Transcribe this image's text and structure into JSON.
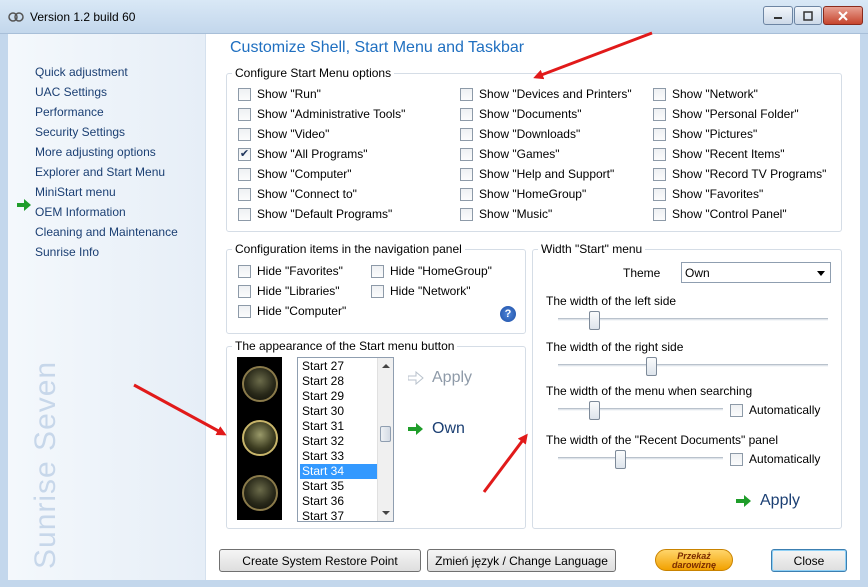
{
  "window": {
    "title": "Version 1.2 build 60"
  },
  "sidebar": {
    "items": [
      {
        "label": "Quick adjustment"
      },
      {
        "label": "UAC Settings"
      },
      {
        "label": "Performance"
      },
      {
        "label": "Security Settings"
      },
      {
        "label": "More adjusting options"
      },
      {
        "label": "Explorer and Start Menu",
        "active": true
      },
      {
        "label": "MiniStart menu"
      },
      {
        "label": "OEM Information"
      },
      {
        "label": "Cleaning and Maintenance"
      },
      {
        "label": "Sunrise Info"
      }
    ],
    "brand": "Sunrise Seven"
  },
  "main": {
    "title": "Customize Shell, Start Menu and Taskbar",
    "start_menu_options": {
      "legend": "Configure Start Menu options",
      "col1": [
        {
          "label": "Show \"Run\"",
          "checked": false
        },
        {
          "label": "Show \"Administrative Tools\"",
          "checked": false
        },
        {
          "label": "Show \"Video\"",
          "checked": false
        },
        {
          "label": "Show \"All Programs\"",
          "checked": true
        },
        {
          "label": "Show \"Computer\"",
          "checked": false
        },
        {
          "label": "Show \"Connect to\"",
          "checked": false
        },
        {
          "label": "Show \"Default Programs\"",
          "checked": false
        }
      ],
      "col2": [
        {
          "label": "Show \"Devices and Printers\"",
          "checked": false
        },
        {
          "label": "Show \"Documents\"",
          "checked": false
        },
        {
          "label": "Show \"Downloads\"",
          "checked": false
        },
        {
          "label": "Show \"Games\"",
          "checked": false
        },
        {
          "label": "Show \"Help and Support\"",
          "checked": false
        },
        {
          "label": "Show \"HomeGroup\"",
          "checked": false
        },
        {
          "label": "Show \"Music\"",
          "checked": false
        }
      ],
      "col3": [
        {
          "label": "Show \"Network\"",
          "checked": false
        },
        {
          "label": "Show \"Personal Folder\"",
          "checked": false
        },
        {
          "label": "Show \"Pictures\"",
          "checked": false
        },
        {
          "label": "Show \"Recent Items\"",
          "checked": false
        },
        {
          "label": "Show \"Record TV Programs\"",
          "checked": false
        },
        {
          "label": "Show \"Favorites\"",
          "checked": false
        },
        {
          "label": "Show \"Control Panel\"",
          "checked": false
        }
      ]
    },
    "nav_panel": {
      "legend": "Configuration items in the navigation panel",
      "items": [
        {
          "label": "Hide \"Favorites\"",
          "checked": false
        },
        {
          "label": "Hide \"HomeGroup\"",
          "checked": false
        },
        {
          "label": "Hide \"Libraries\"",
          "checked": false
        },
        {
          "label": "Hide \"Network\"",
          "checked": false
        },
        {
          "label": "Hide \"Computer\"",
          "checked": false
        }
      ],
      "help_glyph": "?"
    },
    "start_button": {
      "legend": "The appearance of the Start menu button",
      "list": [
        "Start 27",
        "Start 28",
        "Start 29",
        "Start 30",
        "Start 31",
        "Start 32",
        "Start 33",
        "Start 34",
        "Start 35",
        "Start 36",
        "Start 37"
      ],
      "selected": "Start 34",
      "apply_label": "Apply",
      "own_label": "Own"
    },
    "width_menu": {
      "legend": "Width \"Start\" menu",
      "theme_label": "Theme",
      "theme_value": "Own",
      "left_label": "The width of the left side",
      "right_label": "The width of the right side",
      "search_label": "The width of the menu when searching",
      "recent_label": "The width of the \"Recent Documents\" panel",
      "auto_label": "Automatically",
      "apply_label": "Apply",
      "left_value": 0.12,
      "right_value": 0.34,
      "search_value": 0.2,
      "recent_value": 0.37
    },
    "buttons": {
      "restore": "Create System Restore Point",
      "language": "Zmień język / Change Language",
      "donate_line1": "Przekaż",
      "donate_line2": "darowiznę",
      "close": "Close"
    }
  },
  "colors": {
    "title_blue": "#1f6fc0",
    "selection": "#3399ff",
    "arrow_red": "#e11a1a",
    "green": "#1f9d2a"
  }
}
